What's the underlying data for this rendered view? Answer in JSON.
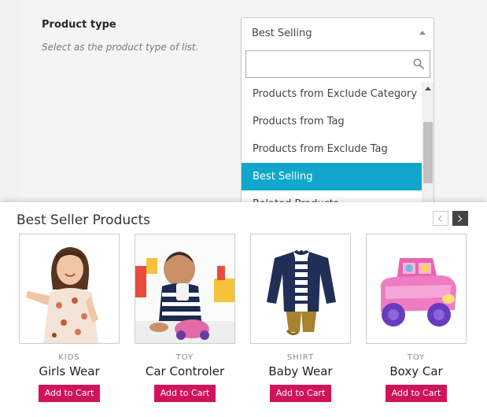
{
  "settings": {
    "label": "Product type",
    "description": "Select as the product type of list.",
    "selected_value": "Best Selling",
    "search_placeholder": "",
    "options": [
      {
        "label": "Products from Exclude Category",
        "active": false
      },
      {
        "label": "Products from Tag",
        "active": false
      },
      {
        "label": "Products from Exclude Tag",
        "active": false
      },
      {
        "label": "Best Selling",
        "active": true
      },
      {
        "label": "Related Products",
        "active": false
      }
    ]
  },
  "showcase": {
    "title": "Best Seller Products",
    "products": [
      {
        "category": "KIDS",
        "name": "Girls Wear",
        "button": "Add to Cart",
        "image": "girl-photo"
      },
      {
        "category": "TOY",
        "name": "Car Controler",
        "button": "Add to Cart",
        "image": "baby-with-toy-photo"
      },
      {
        "category": "SHIRT",
        "name": "Baby Wear",
        "button": "Add to Cart",
        "image": "baby-jacket-photo"
      },
      {
        "category": "TOY",
        "name": "Boxy Car",
        "button": "Add to Cart",
        "image": "toy-car-photo"
      }
    ]
  },
  "colors": {
    "active_option": "#11a7cc",
    "cart_button": "#d1145a",
    "next_button": "#444444"
  }
}
